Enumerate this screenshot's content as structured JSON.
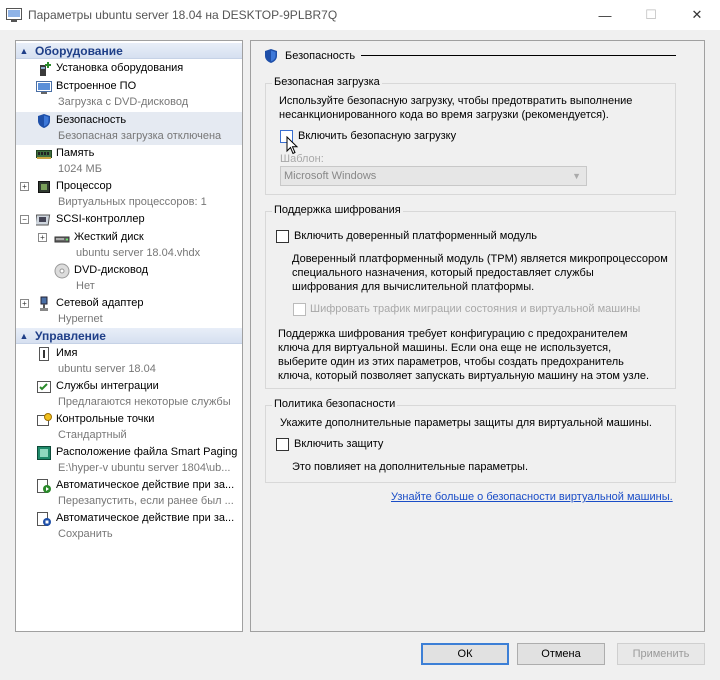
{
  "window": {
    "title": "Параметры ubuntu server 18.04 на DESKTOP-9PLBR7Q",
    "minimize": "—",
    "maximize": "☐",
    "close": "✕"
  },
  "sidebar": {
    "hardware_category": "Оборудование",
    "management_category": "Управление",
    "hardware_items": [
      {
        "label": "Установка оборудования",
        "sub": "",
        "icon": "add-hardware-icon"
      },
      {
        "label": "Встроенное ПО",
        "sub": "Загрузка с DVD-дисковод",
        "icon": "firmware-icon"
      },
      {
        "label": "Безопасность",
        "sub": "Безопасная загрузка отключена",
        "icon": "shield-icon"
      },
      {
        "label": "Память",
        "sub": "1024 МБ",
        "icon": "memory-icon"
      },
      {
        "label": "Процессор",
        "sub": "Виртуальных процессоров: 1",
        "icon": "processor-icon"
      },
      {
        "label": "SCSI-контроллер",
        "sub": "",
        "icon": "scsi-controller-icon"
      },
      {
        "label": "Жесткий диск",
        "sub": "ubuntu server 18.04.vhdx",
        "icon": "hard-disk-icon"
      },
      {
        "label": "DVD-дисковод",
        "sub": "Нет",
        "icon": "dvd-drive-icon"
      },
      {
        "label": "Сетевой адаптер",
        "sub": "Hypernet",
        "icon": "network-adapter-icon"
      }
    ],
    "management_items": [
      {
        "label": "Имя",
        "sub": "ubuntu server 18.04",
        "icon": "name-icon"
      },
      {
        "label": "Службы интеграции",
        "sub": "Предлагаются некоторые службы",
        "icon": "integration-services-icon"
      },
      {
        "label": "Контрольные точки",
        "sub": "Стандартный",
        "icon": "checkpoints-icon"
      },
      {
        "label": "Расположение файла Smart Paging",
        "sub": "E:\\hyper-v ubuntu server 1804\\ub...",
        "icon": "smart-paging-icon"
      },
      {
        "label": "Автоматическое действие при за...",
        "sub": "Перезапустить, если ранее был ...",
        "icon": "auto-start-icon"
      },
      {
        "label": "Автоматическое действие при за...",
        "sub": "Сохранить",
        "icon": "auto-stop-icon"
      }
    ]
  },
  "main": {
    "section_title": "Безопасность",
    "secure_boot": {
      "group_title": "Безопасная загрузка",
      "description_line1": "Используйте безопасную загрузку, чтобы предотвратить выполнение",
      "description_line2": "несанкционированного кода во время загрузки (рекомендуется).",
      "checkbox_label": "Включить безопасную загрузку",
      "template_label": "Шаблон:",
      "template_value": "Microsoft Windows"
    },
    "encryption": {
      "group_title": "Поддержка шифрования",
      "tpm_checkbox_label": "Включить доверенный платформенный модуль",
      "tpm_desc_line1": "Доверенный платформенный модуль (TPM) является микропроцессором",
      "tpm_desc_line2": "специального назначения, который предоставляет службы",
      "tpm_desc_line3": "шифрования для вычислительной платформы.",
      "migration_checkbox_label": "Шифровать трафик миграции состояния и виртуальной машины",
      "note_line1": "Поддержка шифрования требует конфигурацию с предохранителем",
      "note_line2": "ключа для виртуальной машины. Если она еще не используется,",
      "note_line3": "выберите один из этих параметров, чтобы создать предохранитель",
      "note_line4": "ключа, который позволяет запускать виртуальную машину на этом узле."
    },
    "policy": {
      "group_title": "Политика безопасности",
      "description": "Укажите дополнительные параметры защиты для виртуальной машины.",
      "checkbox_label": "Включить защиту",
      "note": "Это повлияет на дополнительные параметры."
    },
    "learn_more_link": "Узнайте больше о безопасности виртуальной машины."
  },
  "footer": {
    "ok": "ОК",
    "cancel": "Отмена",
    "apply": "Применить"
  },
  "colors": {
    "category_text": "#1f3f88",
    "link": "#1a4dc7",
    "selected_bg": "#e5eaf2"
  }
}
